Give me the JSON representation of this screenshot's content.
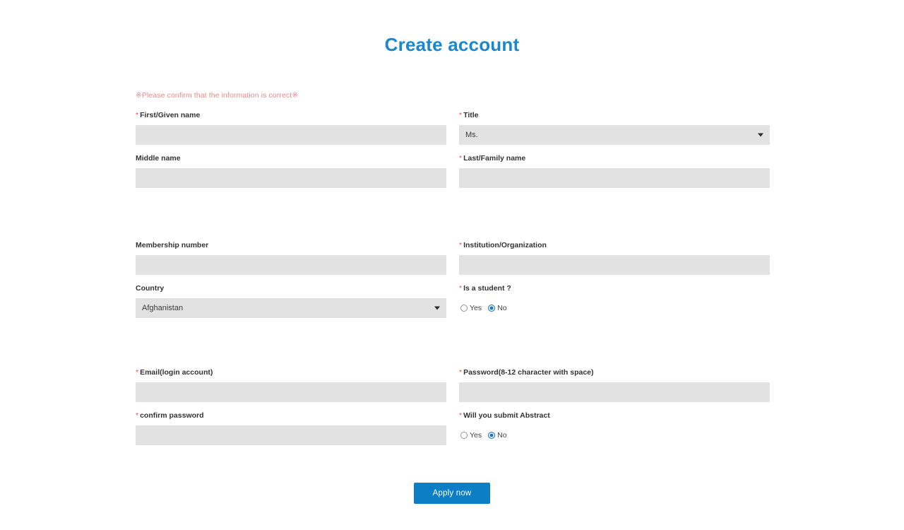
{
  "page": {
    "title": "Create account",
    "notice": "※Please confirm that the information is correct※",
    "title_color": "#1b87ce",
    "accent_color": "#0b7ec6",
    "required_mark_color": "#e2574c",
    "input_bg_color": "#e2e2e2",
    "required_mark": "*"
  },
  "fields": {
    "first_name": {
      "label": "First/Given name",
      "required": true,
      "value": "",
      "placeholder": ""
    },
    "title": {
      "label": "Title",
      "required": true,
      "value": "Ms.",
      "options": [
        "Ms."
      ]
    },
    "middle_name": {
      "label": "Middle name",
      "required": false,
      "value": "",
      "placeholder": ""
    },
    "last_name": {
      "label": "Last/Family name",
      "required": true,
      "value": "",
      "placeholder": ""
    },
    "membership_number": {
      "label": "Membership number",
      "required": false,
      "value": "",
      "placeholder": ""
    },
    "institution": {
      "label": "Institution/Organization",
      "required": true,
      "value": "",
      "placeholder": ""
    },
    "country": {
      "label": "Country",
      "required": false,
      "value": "Afghanistan",
      "options": [
        "Afghanistan"
      ]
    },
    "is_student": {
      "label": "Is a student ?",
      "required": true,
      "selected": "No",
      "options": [
        "Yes",
        "No"
      ],
      "yes_label": "Yes",
      "no_label": "No"
    },
    "email": {
      "label": "Email(login account)",
      "required": true,
      "value": "",
      "placeholder": ""
    },
    "password": {
      "label": "Password(8-12 character with space)",
      "required": true,
      "value": "",
      "placeholder": ""
    },
    "confirm_password": {
      "label": "confirm password",
      "required": true,
      "value": "",
      "placeholder": ""
    },
    "submit_abstract": {
      "label": "Will you submit Abstract",
      "required": true,
      "selected": "No",
      "options": [
        "Yes",
        "No"
      ],
      "yes_label": "Yes",
      "no_label": "No"
    }
  },
  "actions": {
    "submit_label": "Apply now"
  }
}
